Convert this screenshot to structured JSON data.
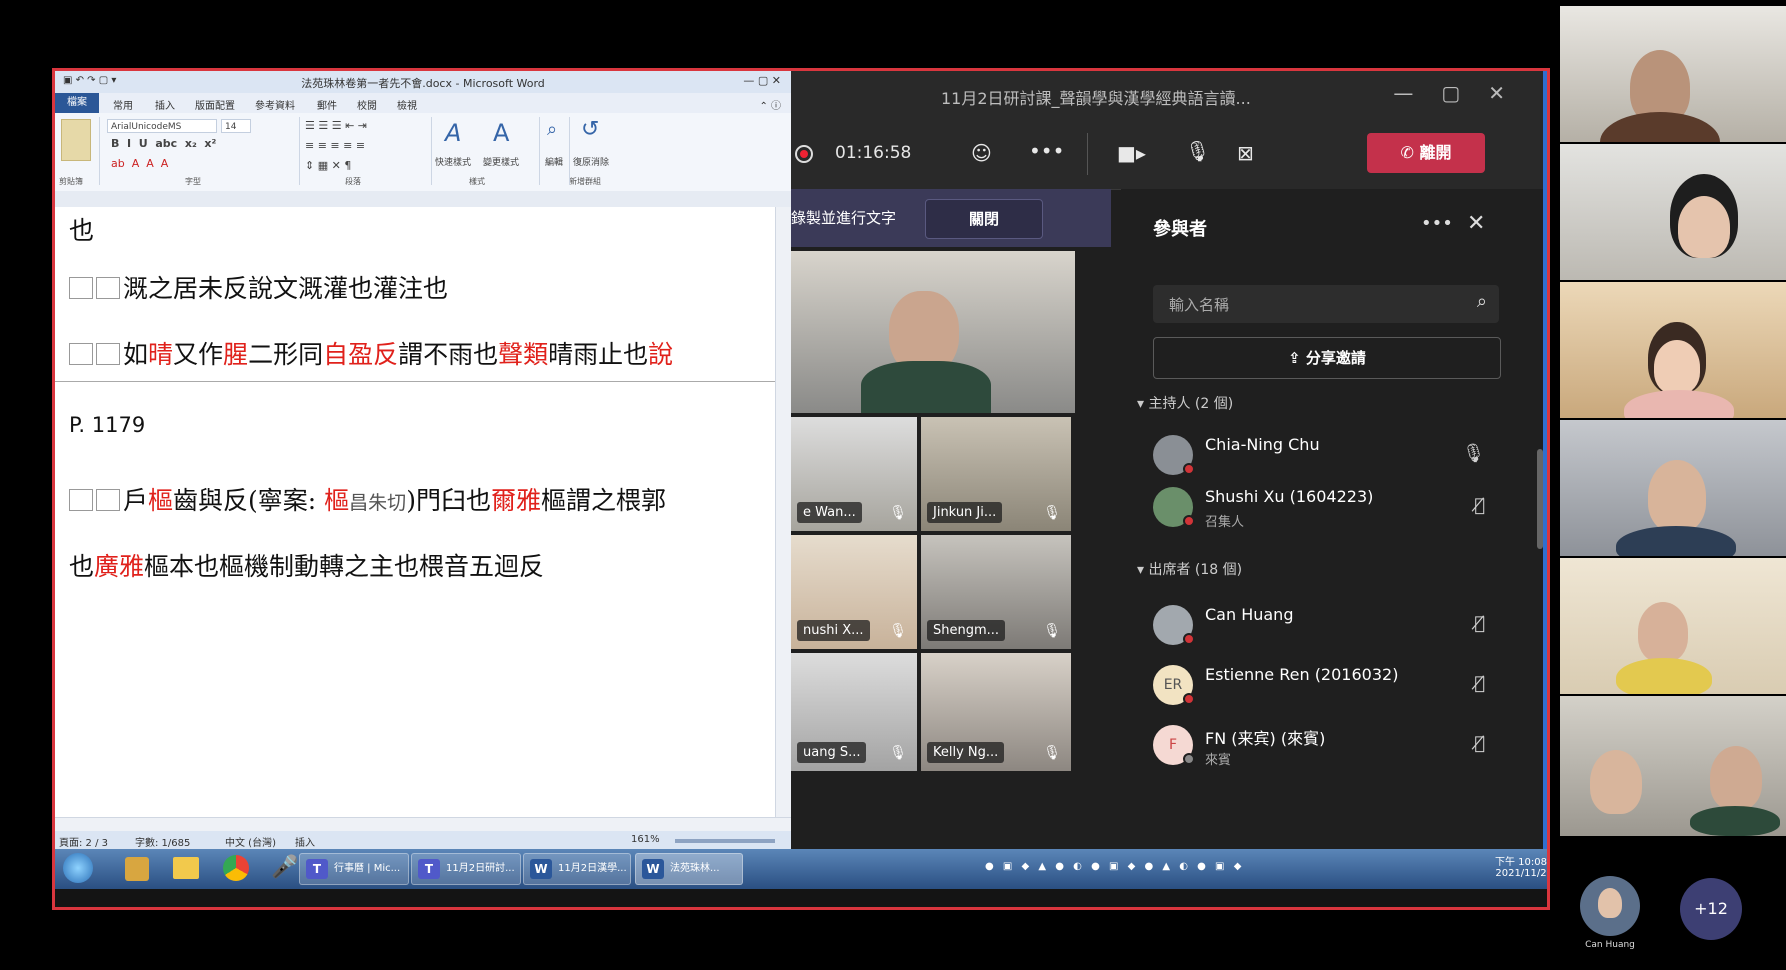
{
  "word": {
    "title": "法苑珠林卷第一者先不會.docx - Microsoft Word",
    "file_tab": "檔案",
    "tabs": [
      "常用",
      "插入",
      "版面配置",
      "參考資料",
      "郵件",
      "校閱",
      "檢視"
    ],
    "font_name": "ArialUnicodeMS",
    "font_size": "14",
    "groups": [
      "剪貼簿",
      "字型",
      "段落",
      "樣式",
      "新增群組"
    ],
    "ribbon_buttons": [
      "快速樣式",
      "變更樣式",
      "編輯",
      "復原消除"
    ],
    "lines": {
      "l0": "也",
      "l1": "溉之居未反說文溉灌也灌注也",
      "l2_a": "如",
      "l2_b": "晴",
      "l2_c": "又作",
      "l2_d": "腥",
      "l2_e": "二形同",
      "l2_f": "自盈反",
      "l2_g": "謂不雨也",
      "l2_h": "聲類",
      "l2_i": "晴雨止也",
      "l2_j": "說",
      "page": "P. 1179",
      "l3_a": "戶",
      "l3_b": "樞",
      "l3_c": "齒與反(寧案: ",
      "l3_d": "樞",
      "l3_e": "昌朱切",
      "l3_f": ")門臼也",
      "l3_g": "爾雅",
      "l3_h": "樞謂之椳郭",
      "l4_a": "也",
      "l4_b": "廣雅",
      "l4_c": "樞本也樞機制動轉之主也椳音五迴反"
    },
    "status": {
      "page": "頁面: 2 / 3",
      "words": "字數: 1/685",
      "lang": "中文 (台灣)",
      "mode": "插入",
      "zoom": "161%"
    }
  },
  "taskbar": {
    "items": [
      {
        "label": "行事曆 | Mic..."
      },
      {
        "label": "11月2日研討..."
      },
      {
        "label": "11月2日漢學..."
      },
      {
        "label": "法苑珠林..."
      }
    ],
    "time": "下午 10:08",
    "date": "2021/11/2"
  },
  "teams": {
    "title": "11月2日研討課_聲韻學與漢學經典語言讀...",
    "timer": "01:16:58",
    "leave_label": "離開",
    "caption_text": "錄製並進行文字",
    "close_label": "關閉",
    "tiles": [
      "e Wan...",
      "Jinkun Ji...",
      "nushi X...",
      "Shengm...",
      "uang S...",
      "Kelly Ng..."
    ],
    "panel": {
      "title": "參與者",
      "search_placeholder": "輸入名稱",
      "share_label": "分享邀請",
      "hosts_header": "主持人 (2 個)",
      "attendees_header": "出席者 (18 個)",
      "participants": [
        {
          "name": "Chia-Ning Chu",
          "role": "",
          "initials": ""
        },
        {
          "name": "Shushi Xu (1604223)",
          "role": "召集人",
          "initials": ""
        },
        {
          "name": "Can Huang",
          "role": "",
          "initials": ""
        },
        {
          "name": "Estienne Ren (2016032)",
          "role": "",
          "initials": "ER"
        },
        {
          "name": "FN (来宾) (來賓)",
          "role": "來賓",
          "initials": "F"
        }
      ]
    }
  },
  "right_strip": {
    "self_name": "Can Huang",
    "more_count": "+12"
  }
}
